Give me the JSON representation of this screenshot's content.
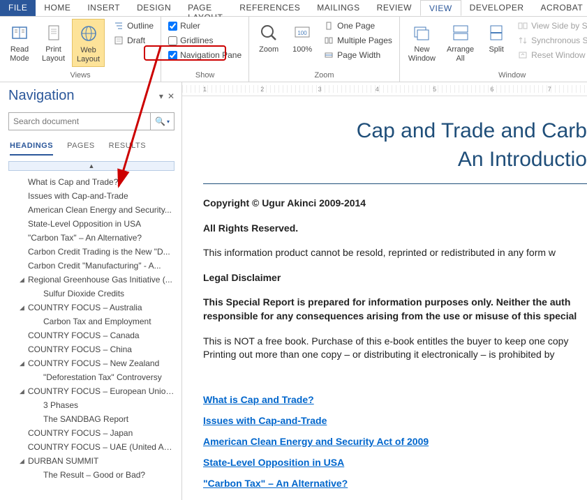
{
  "tabs": {
    "file": "FILE",
    "home": "HOME",
    "insert": "INSERT",
    "design": "DESIGN",
    "pagelayout": "PAGE LAYOUT",
    "references": "REFERENCES",
    "mailings": "MAILINGS",
    "review": "REVIEW",
    "view": "VIEW",
    "developer": "DEVELOPER",
    "acrobat": "ACROBAT"
  },
  "ribbon": {
    "views": {
      "label": "Views",
      "readmode": "Read\nMode",
      "printlayout": "Print\nLayout",
      "weblayout": "Web\nLayout",
      "outline": "Outline",
      "draft": "Draft"
    },
    "show": {
      "label": "Show",
      "ruler": "Ruler",
      "gridlines": "Gridlines",
      "navpane": "Navigation Pane"
    },
    "zoom": {
      "label": "Zoom",
      "zoom": "Zoom",
      "pct": "100%",
      "onepage": "One Page",
      "multipages": "Multiple Pages",
      "pagewidth": "Page Width"
    },
    "window": {
      "label": "Window",
      "newwin": "New\nWindow",
      "arrange": "Arrange\nAll",
      "split": "Split",
      "sidebyside": "View Side by Side",
      "syncscroll": "Synchronous Scrolling",
      "resetpos": "Reset Window Position"
    }
  },
  "nav": {
    "title": "Navigation",
    "search_placeholder": "Search document",
    "tabs": {
      "headings": "HEADINGS",
      "pages": "PAGES",
      "results": "RESULTS"
    },
    "headings": [
      {
        "level": 1,
        "caret": "",
        "text": "What is Cap and Trade?"
      },
      {
        "level": 1,
        "caret": "",
        "text": "Issues with Cap-and-Trade"
      },
      {
        "level": 1,
        "caret": "",
        "text": "American Clean Energy and Security..."
      },
      {
        "level": 1,
        "caret": "",
        "text": "State-Level Opposition in USA"
      },
      {
        "level": 1,
        "caret": "",
        "text": "\"Carbon Tax\" – An Alternative?"
      },
      {
        "level": 1,
        "caret": "",
        "text": "Carbon Credit Trading is the New \"D..."
      },
      {
        "level": 1,
        "caret": "",
        "text": "Carbon Credit \"Manufacturing\" - A..."
      },
      {
        "level": 1,
        "caret": "◢",
        "text": "Regional Greenhouse Gas Initiative (..."
      },
      {
        "level": 2,
        "caret": "",
        "text": "Sulfur Dioxide Credits"
      },
      {
        "level": 1,
        "caret": "◢",
        "text": "COUNTRY FOCUS – Australia"
      },
      {
        "level": 2,
        "caret": "",
        "text": "Carbon Tax and Employment"
      },
      {
        "level": 1,
        "caret": "",
        "text": "COUNTRY FOCUS – Canada"
      },
      {
        "level": 1,
        "caret": "",
        "text": "COUNTRY FOCUS – China"
      },
      {
        "level": 1,
        "caret": "◢",
        "text": "COUNTRY FOCUS – New Zealand"
      },
      {
        "level": 2,
        "caret": "",
        "text": "\"Deforestation Tax\" Controversy"
      },
      {
        "level": 1,
        "caret": "◢",
        "text": "COUNTRY FOCUS – European Union..."
      },
      {
        "level": 2,
        "caret": "",
        "text": "3 Phases"
      },
      {
        "level": 2,
        "caret": "",
        "text": "The SANDBAG Report"
      },
      {
        "level": 1,
        "caret": "",
        "text": "COUNTRY FOCUS – Japan"
      },
      {
        "level": 1,
        "caret": "",
        "text": "COUNTRY FOCUS – UAE (United Ara..."
      },
      {
        "level": 1,
        "caret": "◢",
        "text": "DURBAN SUMMIT"
      },
      {
        "level": 2,
        "caret": "",
        "text": "The Result – Good or Bad?"
      }
    ]
  },
  "ruler": {
    "marks": [
      "1",
      "2",
      "3",
      "4",
      "5",
      "6",
      "7"
    ]
  },
  "doc": {
    "title1": "Cap and Trade and Carb",
    "title2": "An Introductio",
    "p1": "Copyright © Ugur Akinci 2009-2014",
    "p2": "All Rights Reserved.",
    "p3": "This information product cannot be resold, reprinted or redistributed in any form w",
    "p4": "Legal Disclaimer",
    "p5": "This Special Report is prepared for information purposes only. Neither the auth responsible for any consequences arising from the use or misuse of this special",
    "p6": "This is NOT a free book. Purchase of this e-book entitles the buyer to keep one copy Printing out more than one copy – or distributing it electronically – is prohibited by",
    "links": [
      "What is Cap and Trade?",
      "Issues with Cap-and-Trade",
      "American Clean Energy and Security Act of 2009",
      "State-Level Opposition in USA",
      "\"Carbon Tax\" – An Alternative?"
    ]
  }
}
